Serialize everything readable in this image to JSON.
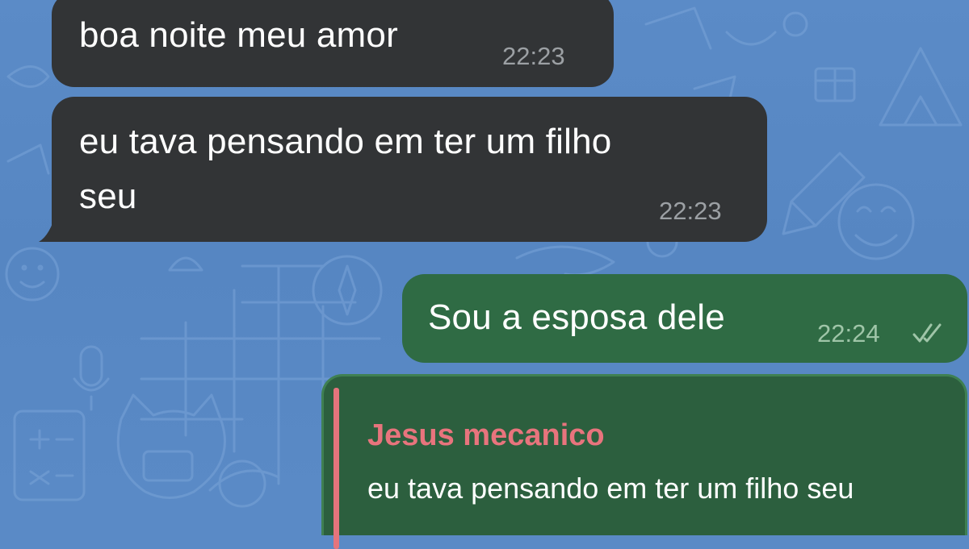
{
  "messages": [
    {
      "direction": "incoming",
      "text": "boa noite meu amor",
      "time": "22:23"
    },
    {
      "direction": "incoming",
      "lines": [
        "eu tava pensando em ter um filho",
        "seu"
      ],
      "time": "22:23"
    },
    {
      "direction": "outgoing",
      "text": "Sou a esposa dele",
      "time": "22:24",
      "status_icon": "double-check-icon"
    },
    {
      "direction": "outgoing",
      "reply": {
        "sender": "Jesus mecanico",
        "quote": "eu tava pensando em ter um filho seu"
      }
    }
  ],
  "colors": {
    "wallpaper": "#5a8ac6",
    "incoming_bubble": "#323436",
    "outgoing_bubble": "#2f6b44",
    "reply_accent": "#e8747d"
  }
}
